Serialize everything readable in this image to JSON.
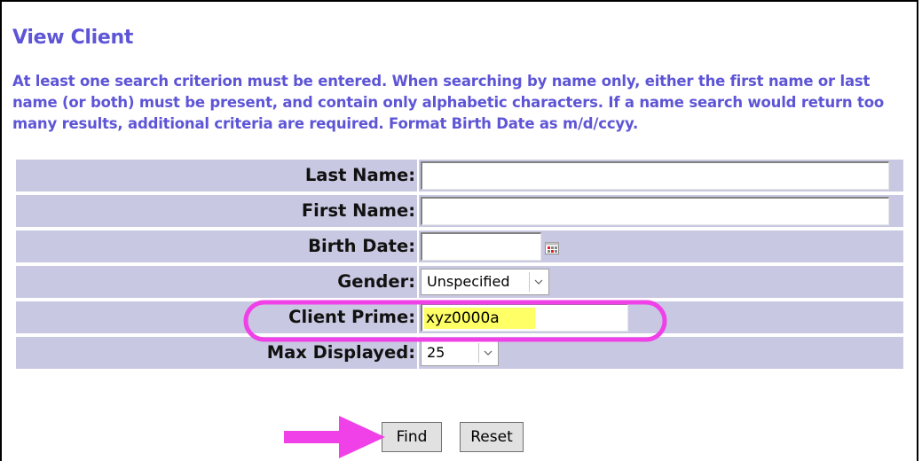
{
  "page": {
    "title": "View Client",
    "instructions": "At least one search criterion must be entered. When searching by name only, either the first name or last name (or both) must be present, and contain only alphabetic characters. If a name search would return too many results, additional criteria are required. Format Birth Date as m/d/ccyy."
  },
  "form": {
    "last_name": {
      "label": "Last Name:",
      "value": ""
    },
    "first_name": {
      "label": "First Name:",
      "value": ""
    },
    "birth_date": {
      "label": "Birth Date:",
      "value": "",
      "icon": "calendar-icon"
    },
    "gender": {
      "label": "Gender:",
      "selected": "Unspecified"
    },
    "client_prime": {
      "label": "Client Prime:",
      "value": "xyz0000a"
    },
    "max_displayed": {
      "label": "Max Displayed:",
      "selected": "25"
    }
  },
  "buttons": {
    "find": "Find",
    "reset": "Reset"
  },
  "annotations": {
    "highlight_color": "#f040e8",
    "value_highlight_color": "#ffff66"
  },
  "colors": {
    "accent": "#5e55d6",
    "label_background": "#c8c8e2"
  }
}
